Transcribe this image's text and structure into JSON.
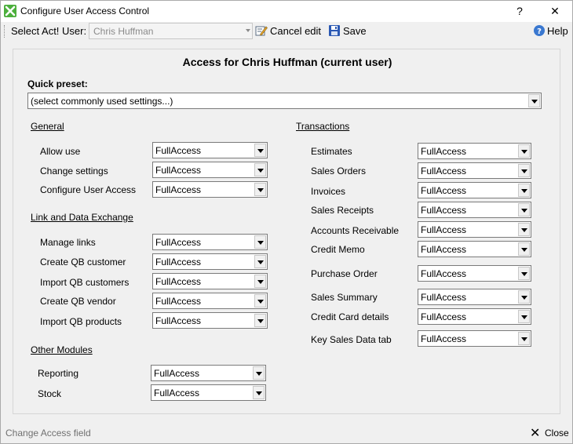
{
  "window": {
    "title": "Configure User Access Control",
    "help_glyph": "?",
    "close_glyph": "✕",
    "accent": "#4caf3c"
  },
  "toolbar": {
    "select_label": "Select Act! User:",
    "user_value": "Chris Huffman",
    "cancel_label": "Cancel edit",
    "save_label": "Save",
    "help_label": "Help"
  },
  "panel": {
    "heading": "Access for Chris Huffman (current user)",
    "quick_preset_label": "Quick preset:",
    "quick_preset_value": "(select commonly used settings...)"
  },
  "sections": {
    "general": {
      "title": "General",
      "fields": [
        {
          "label": "Allow use",
          "value": "FullAccess"
        },
        {
          "label": "Change settings",
          "value": "FullAccess"
        },
        {
          "label": "Configure User Access",
          "value": "FullAccess"
        }
      ]
    },
    "link": {
      "title": "Link and Data Exchange",
      "fields": [
        {
          "label": "Manage links",
          "value": "FullAccess"
        },
        {
          "label": "Create QB customer",
          "value": "FullAccess"
        },
        {
          "label": "Import QB customers",
          "value": "FullAccess"
        },
        {
          "label": "Create QB vendor",
          "value": "FullAccess"
        },
        {
          "label": "Import QB products",
          "value": "FullAccess"
        }
      ]
    },
    "other": {
      "title": "Other Modules",
      "fields": [
        {
          "label": "Reporting",
          "value": "FullAccess"
        },
        {
          "label": "Stock",
          "value": "FullAccess"
        }
      ]
    },
    "transactions": {
      "title": "Transactions",
      "fields": [
        {
          "label": "Estimates",
          "value": "FullAccess"
        },
        {
          "label": "Sales Orders",
          "value": "FullAccess"
        },
        {
          "label": "Invoices",
          "value": "FullAccess"
        },
        {
          "label": "Sales Receipts",
          "value": "FullAccess"
        },
        {
          "label": "Accounts Receivable",
          "value": "FullAccess"
        },
        {
          "label": "Credit Memo",
          "value": "FullAccess"
        },
        {
          "label": "Purchase Order",
          "value": "FullAccess"
        },
        {
          "label": "Sales Summary",
          "value": "FullAccess"
        },
        {
          "label": "Credit Card details",
          "value": "FullAccess"
        },
        {
          "label": "Key Sales Data tab",
          "value": "FullAccess"
        }
      ]
    }
  },
  "statusbar": {
    "status_text": "Change Access field",
    "close_label": "Close",
    "close_glyph": "✕"
  }
}
